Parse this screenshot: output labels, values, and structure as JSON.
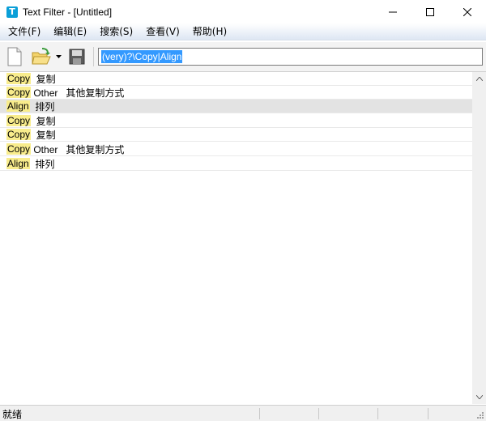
{
  "window": {
    "title": "Text Filter - [Untitled]",
    "app_icon_glyph": "T",
    "accent": "#0a9fd8"
  },
  "menu": {
    "items": [
      {
        "label": "文件(F)"
      },
      {
        "label": "编辑(E)"
      },
      {
        "label": "搜索(S)"
      },
      {
        "label": "查看(V)"
      },
      {
        "label": "帮助(H)"
      }
    ]
  },
  "toolbar": {
    "icons": [
      "new-file-icon",
      "open-folder-icon",
      "dropdown-arrow-icon",
      "save-disk-icon"
    ],
    "filter_value": "(very)?\\Copy|Align"
  },
  "rows": [
    {
      "match": "Copy",
      "rest": "  复制",
      "selected": false
    },
    {
      "match": "Copy",
      "rest": " Other   其他复制方式",
      "selected": false
    },
    {
      "match": "Align",
      "rest": "  排列",
      "selected": true
    },
    {
      "match": "Copy",
      "rest": "  复制",
      "selected": false
    },
    {
      "match": "Copy",
      "rest": "  复制",
      "selected": false
    },
    {
      "match": "Copy",
      "rest": " Other   其他复制方式",
      "selected": false
    },
    {
      "match": "Align",
      "rest": "  排列",
      "selected": false
    }
  ],
  "colors": {
    "match_highlight": "#f8ec8c",
    "selection": "#3399ff",
    "selected_row": "#e3e3e3"
  },
  "status": {
    "text": "就绪"
  }
}
